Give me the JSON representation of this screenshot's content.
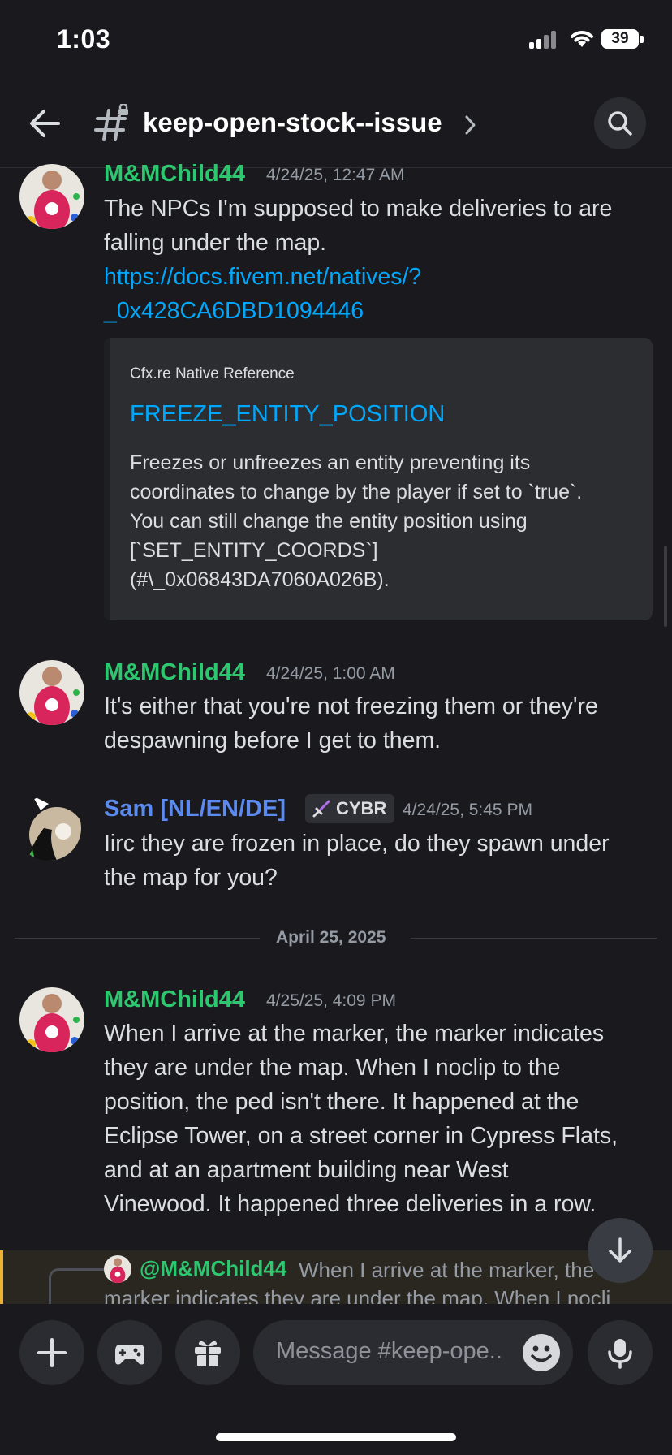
{
  "status_bar": {
    "time": "1:03",
    "battery": "39"
  },
  "header": {
    "channel_name": "keep-open-stock--issue"
  },
  "messages": [
    {
      "author": "M&MChild44",
      "timestamp": "4/24/25, 12:47 AM",
      "lines": [
        "The NPCs I'm supposed to make deliveries to are",
        "falling under the map."
      ],
      "link_lines": [
        "https://docs.fivem.net/natives/?",
        "_0x428CA6DBD1094446"
      ],
      "embed": {
        "provider": "Cfx.re Native Reference",
        "title": "FREEZE_ENTITY_POSITION",
        "description_lines": [
          "Freezes or unfreezes an entity preventing its",
          "coordinates to change by the player if set to `true`.",
          "You can still change the entity position using",
          "[`SET_ENTITY_COORDS`]",
          "(#\\_0x06843DA7060A026B)."
        ]
      }
    },
    {
      "author": "M&MChild44",
      "timestamp": "4/24/25, 1:00 AM",
      "lines": [
        "It's either that you're not freezing them or they're",
        "despawning before I get to them."
      ]
    },
    {
      "author": "Sam [NL/EN/DE]",
      "role_badge": "CYBR",
      "timestamp": "4/24/25, 5:45 PM",
      "lines": [
        "Iirc they are frozen in place, do they spawn under",
        "the map for you?"
      ]
    },
    {
      "author": "M&MChild44",
      "timestamp": "4/25/25, 4:09 PM",
      "lines": [
        "When I arrive at the marker, the marker indicates",
        "they are under the map. When I noclip to the",
        "position, the ped isn't there. It happened at the",
        "Eclipse Tower, on a street corner in Cypress Flats,",
        "and at an apartment building near West",
        "Vinewood. It happened three deliveries in a row."
      ]
    }
  ],
  "date_divider": "April 25, 2025",
  "reply_preview": {
    "mention": "@M&MChild44",
    "text": "When I arrive at the marker, the",
    "text2": "marker indicates they are under the map. When I nocli"
  },
  "composer": {
    "placeholder": "Message #keep-ope.."
  },
  "colors": {
    "author_green": "#2dc770",
    "author_blue": "#5b8af0",
    "link": "#00a8fc",
    "background": "#1a1a1e"
  },
  "icons": [
    "back-arrow-icon",
    "hash-lock-icon",
    "chevron-right-icon",
    "search-icon",
    "arrow-down-icon",
    "plus-icon",
    "gamepad-icon",
    "gift-icon",
    "emoji-icon",
    "microphone-icon",
    "sword-icon"
  ]
}
